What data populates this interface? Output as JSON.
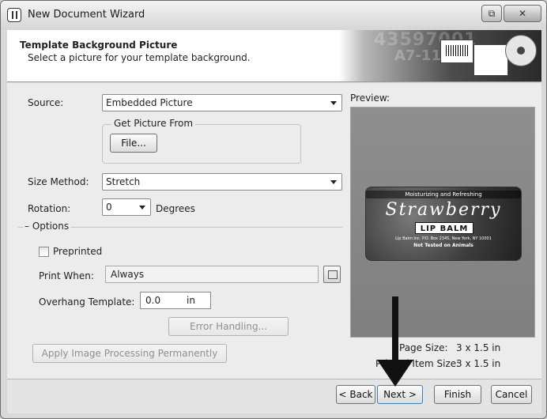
{
  "window": {
    "title": "New Document Wizard",
    "restore_glyph": "⧉",
    "close_glyph": "✕"
  },
  "header": {
    "title": "Template Background Picture",
    "subtitle": "Select a picture for your template background.",
    "banner_number_1": "43597001",
    "banner_number_2": "A7-118"
  },
  "source": {
    "label": "Source:",
    "value": "Embedded Picture"
  },
  "get_picture_from": {
    "legend": "Get Picture From",
    "file_button": "File..."
  },
  "size_method": {
    "label": "Size Method:",
    "value": "Stretch"
  },
  "rotation": {
    "label": "Rotation:",
    "value": "0",
    "unit": "Degrees"
  },
  "options": {
    "legend": "Options",
    "preprinted_label": "Preprinted",
    "preprinted_checked": false,
    "print_when_label": "Print When:",
    "print_when_value": "Always",
    "overhang_label": "Overhang Template:",
    "overhang_value": "0.0",
    "overhang_unit": "in",
    "error_handling_button": "Error Handling..."
  },
  "apply_button": "Apply Image Processing Permanently",
  "preview": {
    "label": "Preview:",
    "label_image": {
      "top_text": "Moisturizing and Refreshing",
      "title": "Strawberry",
      "subtitle": "LIP BALM",
      "address": "Lip Balm Inc. P.O. Box 2345, New York, NY 10001",
      "note": "Not Tested on Animals"
    },
    "page_size_label": "Page Size:",
    "page_size_value": "3 x 1.5 in",
    "printed_item_label": "Printed Item Size:",
    "printed_item_value": "3 x 1.5 in"
  },
  "footer": {
    "back": "< Back",
    "next": "Next >",
    "finish": "Finish",
    "cancel": "Cancel"
  }
}
